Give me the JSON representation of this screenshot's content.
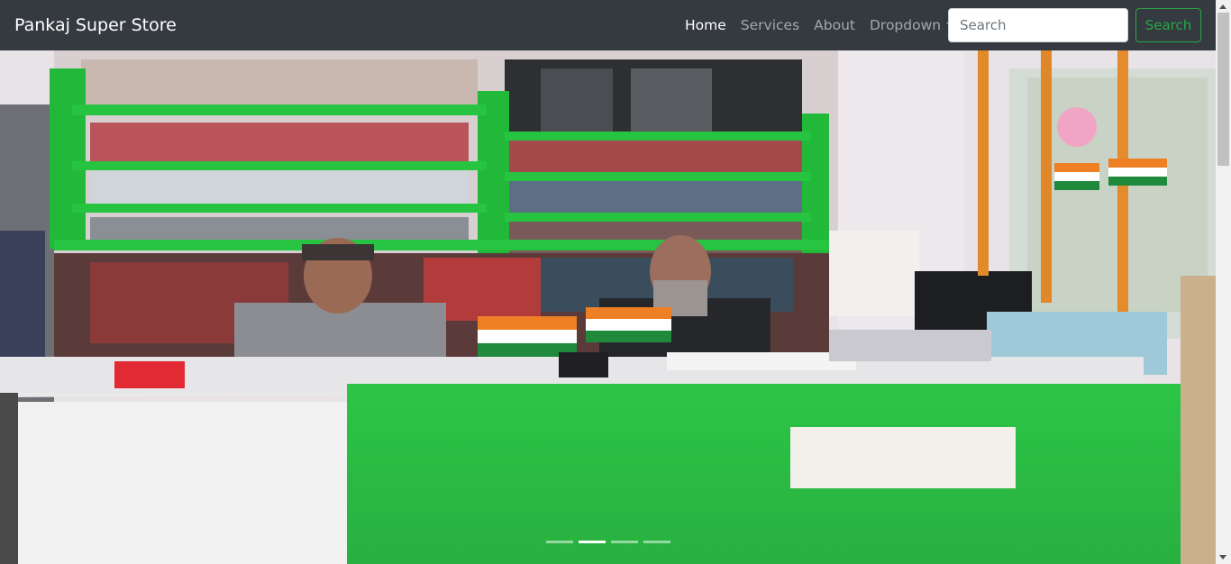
{
  "navbar": {
    "brand": "Pankaj Super Store",
    "links": [
      {
        "label": "Home",
        "active": true
      },
      {
        "label": "Services",
        "active": false
      },
      {
        "label": "About",
        "active": false
      },
      {
        "label": "Dropdown",
        "active": false
      }
    ],
    "search": {
      "placeholder": "Search",
      "value": ""
    },
    "search_button": "Search"
  },
  "carousel": {
    "image_alt": "Pankaj Super Store shop counter with shopkeepers",
    "indicator_count": 4,
    "active_index": 1
  },
  "colors": {
    "navbar_bg": "#343a40",
    "accent": "#28a745",
    "counter_green": "#2fcf4b",
    "shelf_green": "#22b83a"
  },
  "icons": {
    "dropdown": "caret-down-icon"
  }
}
